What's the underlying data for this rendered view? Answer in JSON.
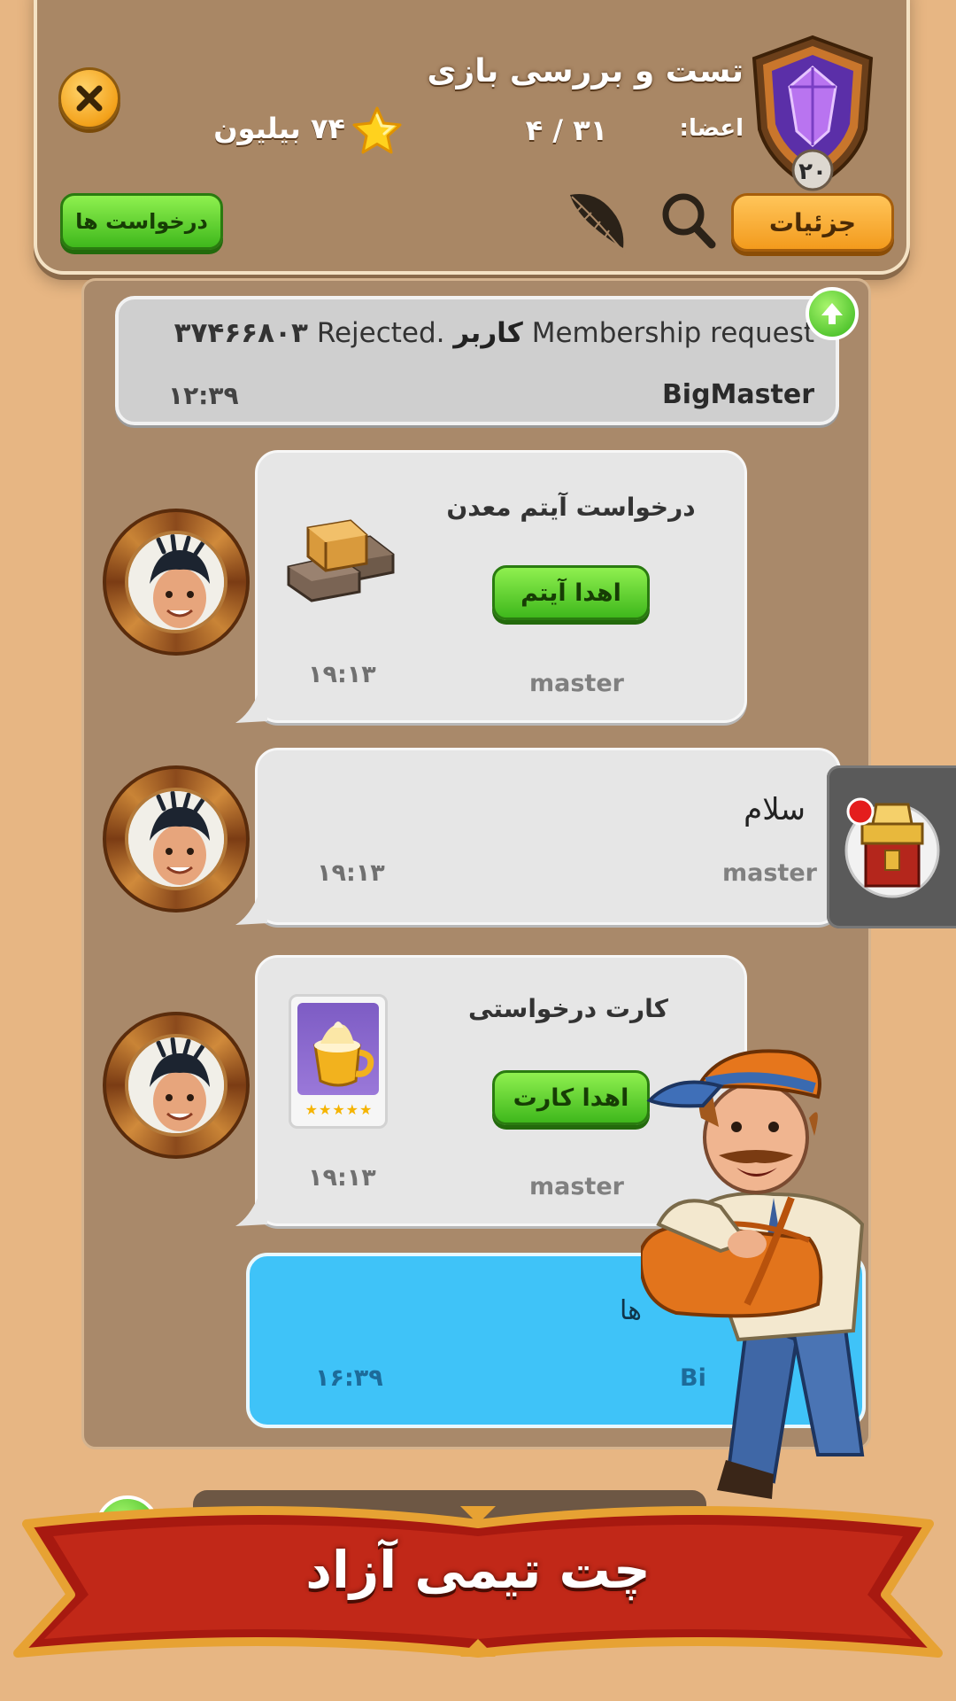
{
  "header": {
    "title": "تست و بررسی بازی",
    "members_label": "اعضا:",
    "members_count": "۳۱ / ۴",
    "wealth": "۷۴ بیلیون",
    "clan_level": "۲۰",
    "details_button": "جزئیات",
    "requests_button": "درخواست ها",
    "icons": [
      "close-icon",
      "star-icon",
      "search-icon",
      "feather-icon",
      "clan-shield-icon"
    ]
  },
  "system_message": {
    "text_before": "Membership request",
    "text_bold": "کاربر",
    "text_after": "Rejected.",
    "user_id": "۳۷۴۶۶۸۰۳",
    "sender": "BigMaster",
    "time": "۱۲:۳۹"
  },
  "messages": [
    {
      "title": "درخواست آیتم معدن",
      "button": "اهدا آیتم",
      "sender": "master",
      "time": "۱۹:۱۳",
      "item_icon": "ore-item-icon"
    },
    {
      "text": "سلام",
      "sender": "master",
      "time": "۱۹:۱۳"
    },
    {
      "title": "کارت درخواستی",
      "button": "اهدا کارت",
      "sender": "master",
      "time": "۱۹:۱۳",
      "item_icon": "coffee-card-icon",
      "card_rating": "★★★★★"
    }
  ],
  "own_message": {
    "text": "ها",
    "sender": "Bi",
    "time": "۱۶:۳۹"
  },
  "banner": {
    "text": "چت تیمی آزاد"
  },
  "colors": {
    "background": "#e7b683",
    "panel": "#a9896a",
    "green_button": "#3fb81c",
    "orange_button": "#f39b1d",
    "own_bubble": "#3fc3f8"
  }
}
